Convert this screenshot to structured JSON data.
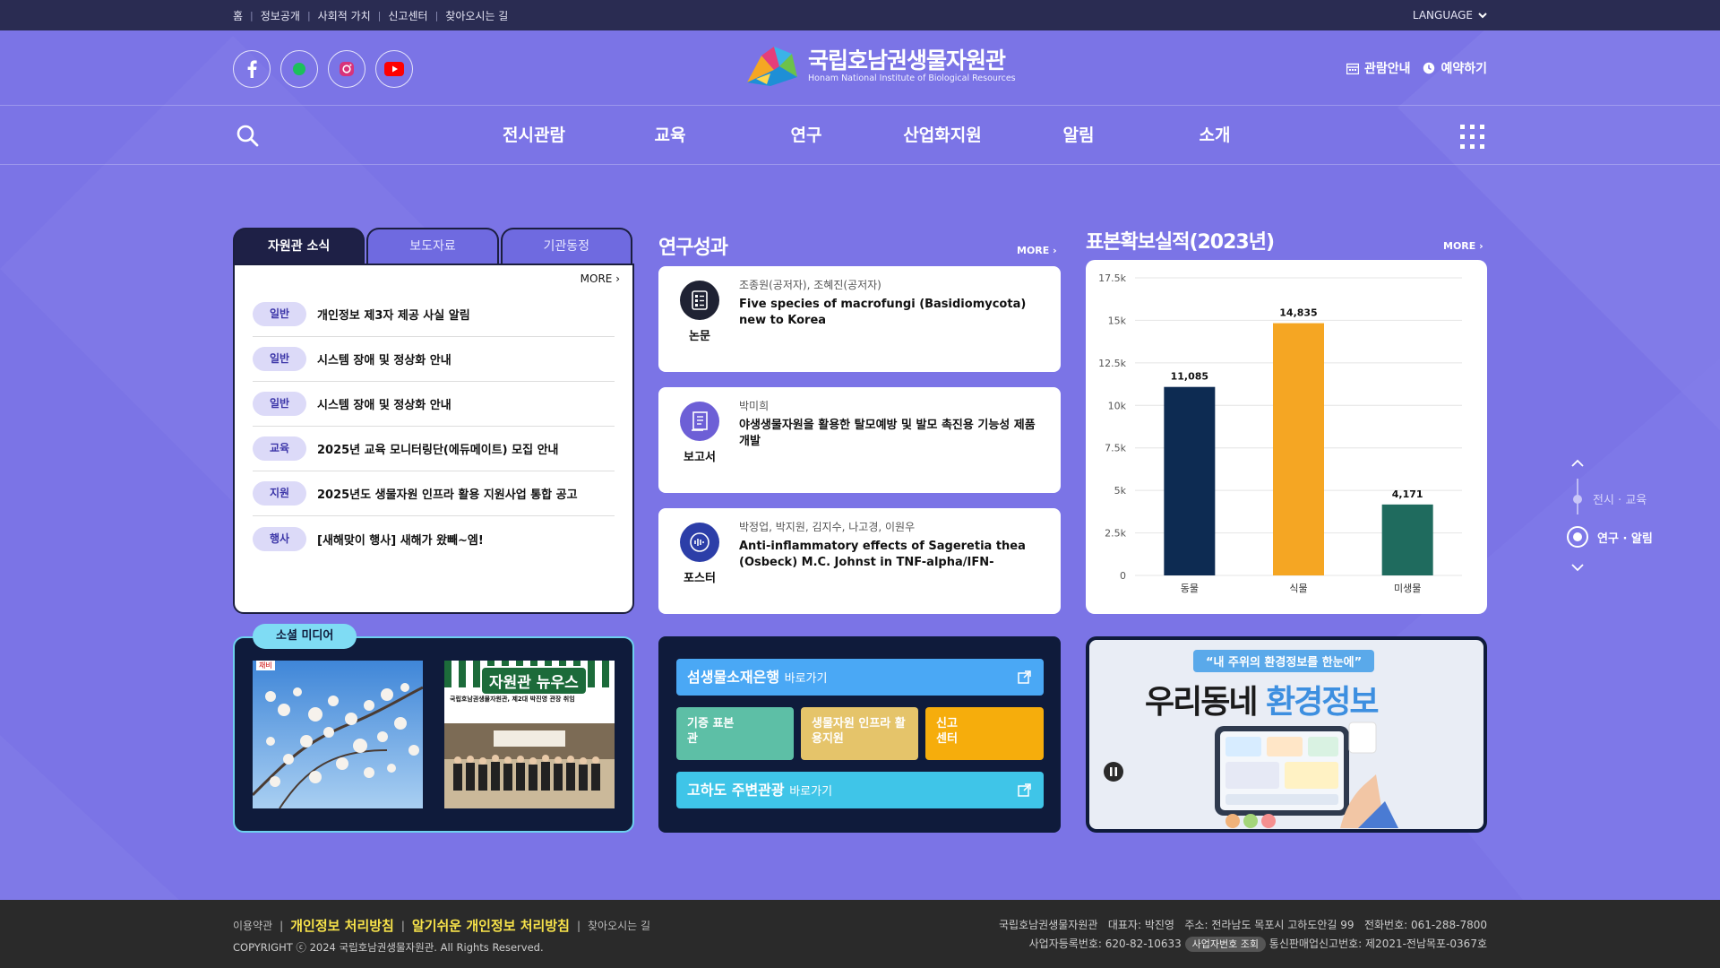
{
  "topbar": {
    "links": [
      "홈",
      "정보공개",
      "사회적 가치",
      "신고센터",
      "찾아오시는 길"
    ],
    "language_label": "LANGUAGE"
  },
  "header": {
    "sns_icons": [
      "facebook-icon",
      "blog-icon",
      "instagram-icon",
      "youtube-icon"
    ],
    "logo_title": "국립호남권생물자원관",
    "logo_subtitle": "Honam National Institute of Biological Resources",
    "guide_label": "관람안내",
    "reserve_label": "예약하기"
  },
  "nav": {
    "items": [
      "전시관람",
      "교육",
      "연구",
      "산업화지원",
      "알림",
      "소개"
    ]
  },
  "news": {
    "tabs": [
      "자원관 소식",
      "보도자료",
      "기관동정"
    ],
    "active_tab": 0,
    "more_label": "MORE",
    "items": [
      {
        "category": "일반",
        "title": "개인정보 제3자 제공 사실 알림"
      },
      {
        "category": "일반",
        "title": "시스템 장애 및 정상화 안내"
      },
      {
        "category": "일반",
        "title": "시스템 장애 및 정상화 안내"
      },
      {
        "category": "교육",
        "title": "2025년 교육 모니터링단(에듀메이트) 모집 안내"
      },
      {
        "category": "지원",
        "title": "2025년도 생물자원 인프라 활용 지원사업 통합 공고"
      },
      {
        "category": "행사",
        "title": "[새해맞이 행사] 새해가 왔빼~엠!"
      }
    ]
  },
  "research": {
    "title": "연구성과",
    "more_label": "MORE",
    "cards": [
      {
        "kind": "논문",
        "authors": "조종원(공저자), 조혜진(공저자)",
        "title": "Five species of macrofungi (Basidiomycota) new to Korea",
        "icon": "document-icon",
        "color": "#1f2233"
      },
      {
        "kind": "보고서",
        "authors": "박미희",
        "title": "야생생물자원을 활용한 탈모예방 및 발모 촉진용 기능성 제품 개발",
        "icon": "report-icon",
        "color": "#6d5fd6"
      },
      {
        "kind": "포스터",
        "authors": "박정업, 박지원, 김지수, 나고경, 이원우",
        "title": "Anti-inflammatory effects of Sageretia thea (Osbeck) M.C. Johnst in TNF-alpha/IFN-gamma-...",
        "icon": "poster-icon",
        "color": "#2c3ea8"
      }
    ]
  },
  "specimen": {
    "title": "표본확보실적(2023년)",
    "more_label": "MORE"
  },
  "chart_data": {
    "type": "bar",
    "title": "표본확보실적(2023년)",
    "categories": [
      "동물",
      "식물",
      "미생물"
    ],
    "values": [
      11085,
      14835,
      4171
    ],
    "value_labels": [
      "11,085",
      "14,835",
      "4,171"
    ],
    "colors": [
      "#0d2b52",
      "#f5a623",
      "#1f6b5e"
    ],
    "ylim": [
      0,
      17500
    ],
    "yticks": [
      0,
      2500,
      5000,
      7500,
      10000,
      12500,
      15000,
      17500
    ],
    "ytick_labels": [
      "0",
      "2.5k",
      "5k",
      "7.5k",
      "10k",
      "12.5k",
      "15k",
      "17.5k"
    ],
    "grid": true
  },
  "social": {
    "tag_label": "소셜 미디어",
    "thumb1_badge": "채비",
    "thumb2_title": "자원관 뉴우스",
    "thumb2_headline": "국립호남권생물자원관, 제2대 박진영 관장 취임"
  },
  "quick": {
    "bank_label": "섬생물소재은행",
    "bank_suffix": "바로가기",
    "donation_label": "기증 표본관",
    "infra_label": "생물자원 인프라 활용지원",
    "report_label": "신고 센터",
    "tour_label": "고하도 주변관광",
    "tour_suffix": "바로가기",
    "colors": {
      "bank": "#4aa8f5",
      "donation": "#5dbfa6",
      "infra": "#e5c46a",
      "report": "#f6ad0c",
      "tour": "#3fc5e8"
    }
  },
  "banner": {
    "quote": "“내 주위의 환경정보를 한눈에”",
    "headline_dark": "우리동네",
    "headline_blue": "환경정보"
  },
  "sidenav": {
    "items": [
      "전시 · 교육",
      "연구 · 알림"
    ],
    "active": 1
  },
  "footer": {
    "links": [
      "이용약관",
      "개인정보 처리방침",
      "알기쉬운 개인정보 처리방침",
      "찾아오시는 길"
    ],
    "copyright": "COPYRIGHT ⓒ 2024 국립호남권생물자원관. All Rights Reserved.",
    "info_line1": "국립호남권생물자원관   대표자: 박진영   주소: 전라남도 목포시 고하도안길 99   전화번호: 061-288-7800",
    "biz_no": "사업자등록번호: 620-82-10633",
    "biz_btn": "사업자번호 조회",
    "mail_order": "통신판매업신고번호: 제2021-전남목포-0367호"
  }
}
